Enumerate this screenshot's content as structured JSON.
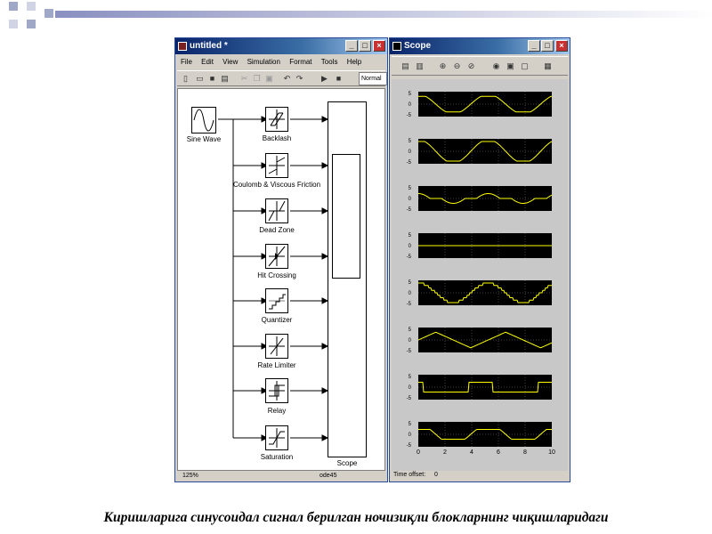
{
  "simulink": {
    "title": "untitled *",
    "menu": [
      "File",
      "Edit",
      "View",
      "Simulation",
      "Format",
      "Tools",
      "Help"
    ],
    "sim_mode": "Normal",
    "status_left": "125%",
    "status_right": "ode45",
    "blocks": {
      "source": "Sine Wave",
      "items": [
        "Backlash",
        "Coulomb & Viscous Friction",
        "Dead Zone",
        "Hit Crossing",
        "Quantizer",
        "Rate Limiter",
        "Relay",
        "Saturation"
      ],
      "sink": "Scope"
    }
  },
  "scope": {
    "title": "Scope",
    "xticks": [
      "0",
      "2",
      "4",
      "6",
      "8",
      "10"
    ],
    "yticks": [
      "5",
      "0",
      "-5"
    ],
    "time_offset_label": "Time offset:",
    "time_offset_value": "0"
  },
  "caption": "Киришларига синусоидал сигнал берилган ночизиқли блокларнинг чиқишларидаги",
  "colors": {
    "title_bar": "#0a246a",
    "scope_bg": "#000000",
    "trace": "#ffff00"
  }
}
